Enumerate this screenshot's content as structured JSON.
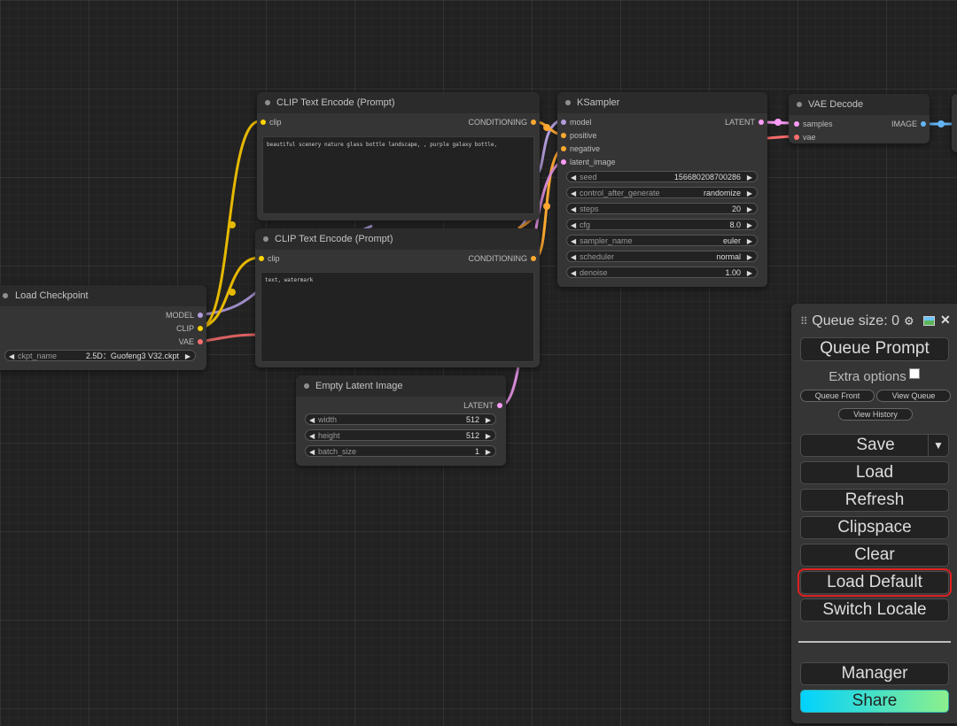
{
  "nodes": {
    "clip_pos": {
      "title": "CLIP Text Encode (Prompt)",
      "input": "clip",
      "output": "CONDITIONING",
      "text": "beautiful scenery nature glass bottle landscape, , purple galaxy bottle,"
    },
    "clip_neg": {
      "title": "CLIP Text Encode (Prompt)",
      "input": "clip",
      "output": "CONDITIONING",
      "text": "text, watermark"
    },
    "ksampler": {
      "title": "KSampler",
      "inputs": [
        "model",
        "positive",
        "negative",
        "latent_image"
      ],
      "output": "LATENT",
      "widgets": [
        {
          "name": "seed",
          "value": "156680208700286"
        },
        {
          "name": "control_after_generate",
          "value": "randomize"
        },
        {
          "name": "steps",
          "value": "20"
        },
        {
          "name": "cfg",
          "value": "8.0"
        },
        {
          "name": "sampler_name",
          "value": "euler"
        },
        {
          "name": "scheduler",
          "value": "normal"
        },
        {
          "name": "denoise",
          "value": "1.00"
        }
      ]
    },
    "vae_decode": {
      "title": "VAE Decode",
      "inputs": [
        "samples",
        "vae"
      ],
      "output": "IMAGE"
    },
    "load_checkpoint": {
      "title": "Load Checkpoint",
      "outputs": [
        "MODEL",
        "CLIP",
        "VAE"
      ],
      "widget": {
        "name": "ckpt_name",
        "value": "2.5D：Guofeng3 V32.ckpt"
      }
    },
    "empty_latent": {
      "title": "Empty Latent Image",
      "output": "LATENT",
      "widgets": [
        {
          "name": "width",
          "value": "512"
        },
        {
          "name": "height",
          "value": "512"
        },
        {
          "name": "batch_size",
          "value": "1"
        }
      ]
    }
  },
  "queue": {
    "queue_size_label": "Queue size: 0",
    "queue_prompt": "Queue Prompt",
    "extra_options": "Extra options",
    "queue_front": "Queue Front",
    "view_queue": "View Queue",
    "view_history": "View History",
    "save": "Save",
    "load": "Load",
    "refresh": "Refresh",
    "clipspace": "Clipspace",
    "clear": "Clear",
    "load_default": "Load Default",
    "switch_locale": "Switch Locale",
    "manager": "Manager",
    "share": "Share",
    "icons": [
      "drag-handle-icon",
      "gear-icon",
      "image-icon",
      "close-icon",
      "dropdown-arrow-icon"
    ]
  },
  "colors": {
    "clip": "#ffd500",
    "conditioning": "#ffa931",
    "model": "#b39ddb",
    "vae": "#ff6e6e",
    "latent": "#ff9cf9",
    "image": "#64b5f6",
    "highlight": "#e02020",
    "share_gradient": [
      "#00d2ff",
      "#8cf08c"
    ]
  }
}
